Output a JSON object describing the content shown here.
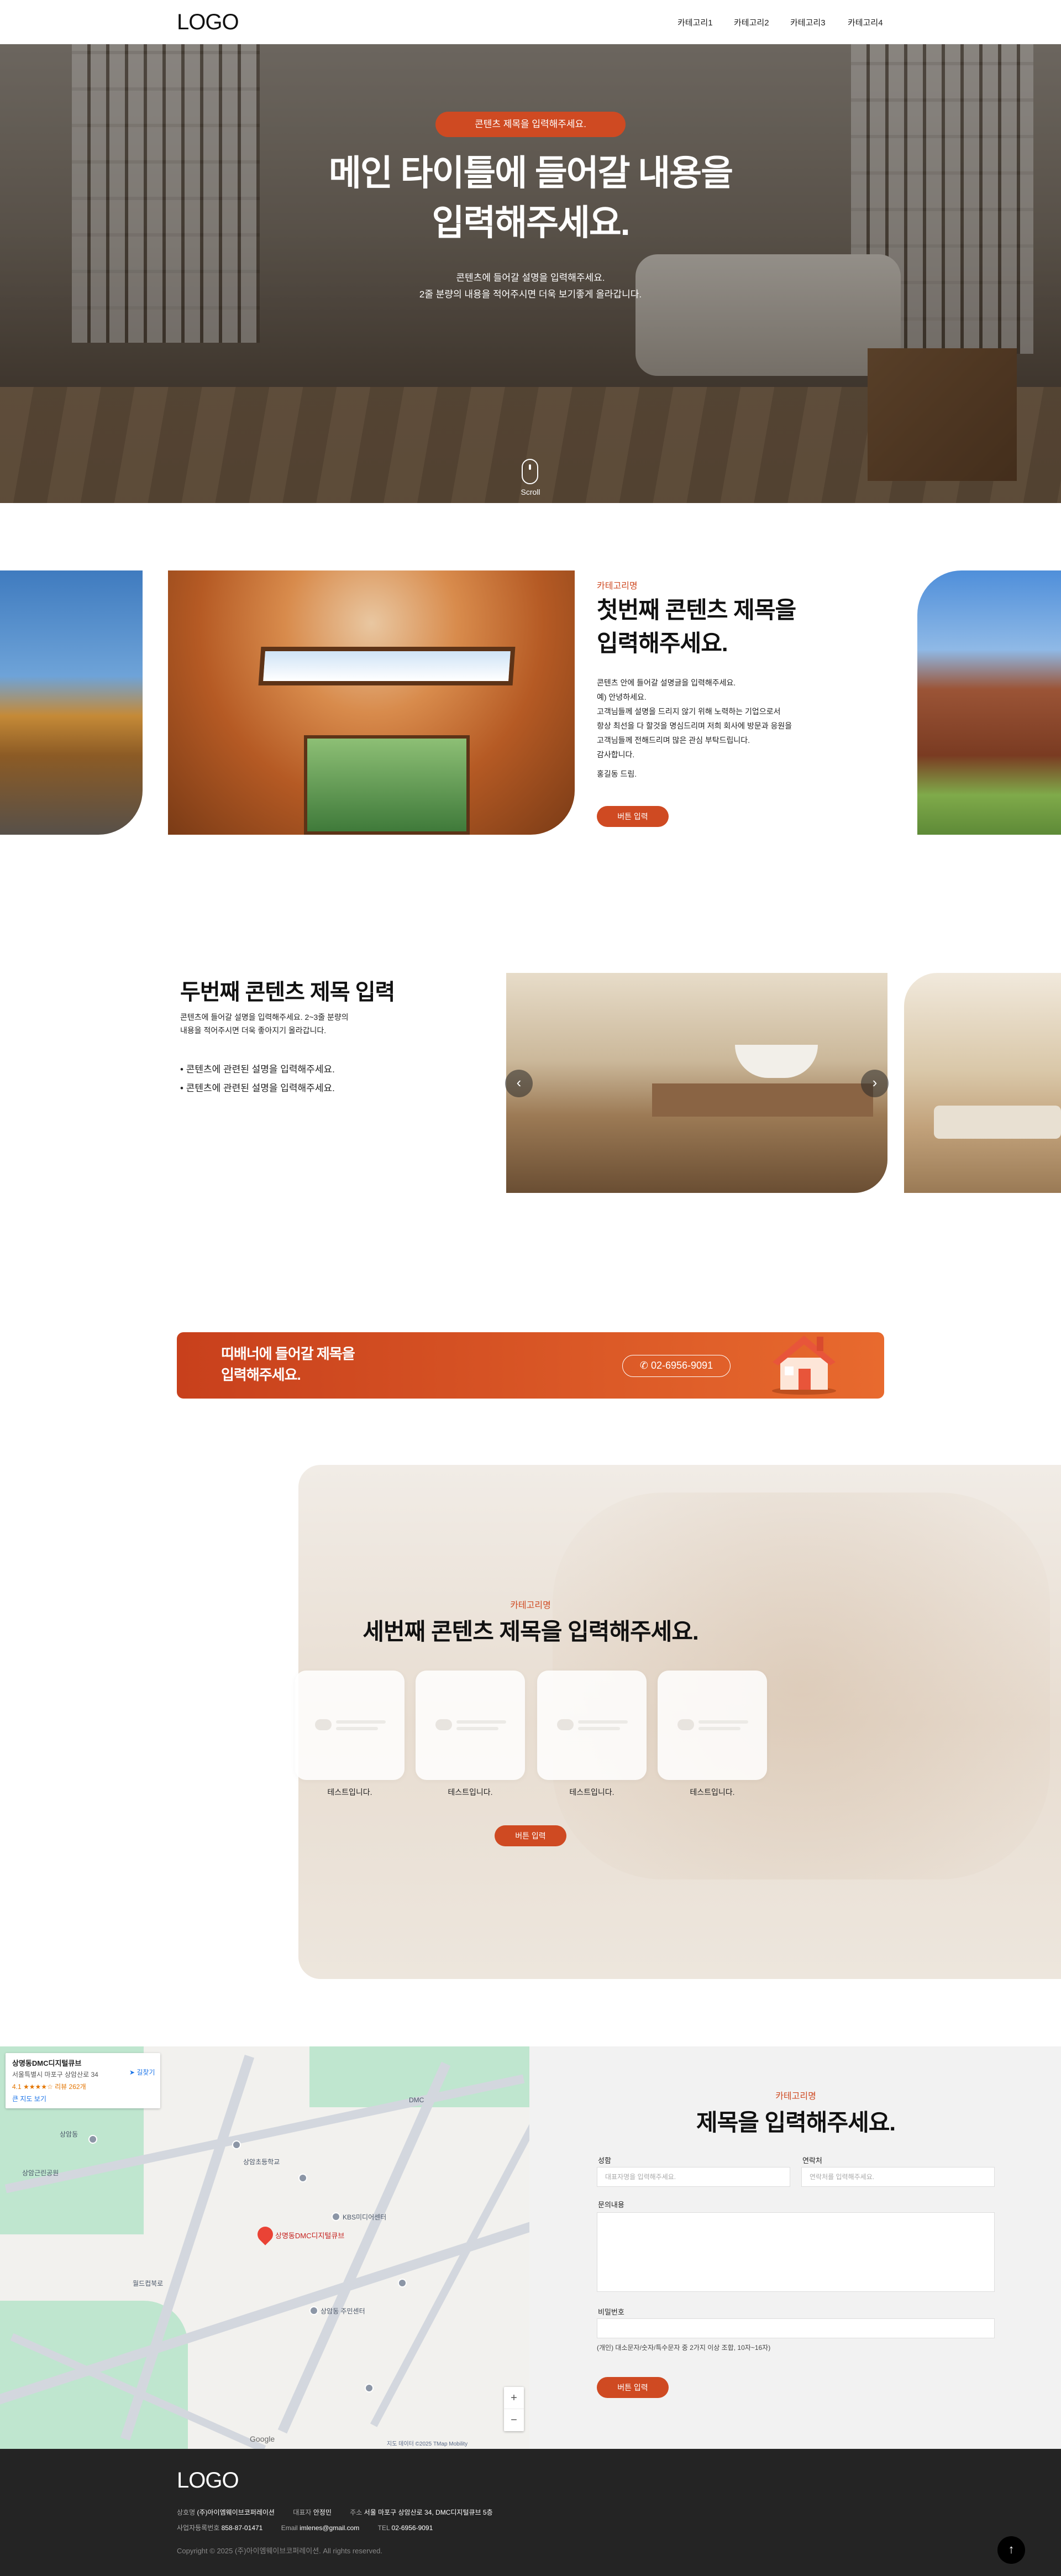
{
  "header": {
    "logo": "LOGO",
    "nav": [
      "카테고리1",
      "카테고리2",
      "카테고리3",
      "카테고리4"
    ]
  },
  "hero": {
    "badge": "콘텐츠 제목을 입력해주세요.",
    "title_line1": "메인 타이틀에 들어갈 내용을",
    "title_line2": "입력해주세요.",
    "desc_line1": "콘텐츠에 들어갈 설명을 입력해주세요.",
    "desc_line2": "2줄 분량의 내용을 적어주시면 더욱 보기좋게 올라갑니다.",
    "scroll": "Scroll"
  },
  "section1": {
    "category": "카테고리명",
    "title_line1": "첫번째 콘텐츠 제목을",
    "title_line2": "입력해주세요.",
    "body": [
      "콘텐츠 안에 들어갈 설명글을 입력해주세요.",
      "예) 안녕하세요.",
      "고객님들께 설명을 드리지 않기 위해 노력하는 기업으로서",
      "항상 최선을 다 할것을 명심드리며 저희 회사에 방문과 응원을",
      "고객님들께 전해드리며 많은 관심 부탁드립니다.",
      "감사합니다."
    ],
    "signature": "홍길동 드림.",
    "button": "버튼 입력"
  },
  "section2": {
    "title": "두번째 콘텐츠 제목 입력",
    "desc_line1": "콘텐츠에 들어갈 설명을 입력해주세요. 2~3줄 분량의",
    "desc_line2": "내용을 적어주시면 더욱 좋아지기 올라갑니다.",
    "bullets": [
      "콘텐츠에 관련된 설명을 입력해주세요.",
      "콘텐츠에 관련된 설명을 입력해주세요."
    ],
    "prev_icon": "‹",
    "next_icon": "›"
  },
  "banner": {
    "title_line1": "띠배너에 들어갈 제목을",
    "title_line2": "입력해주세요.",
    "phone": "02-6956-9091"
  },
  "section3": {
    "category": "카테고리명",
    "title": "세번째 콘텐츠 제목을 입력해주세요.",
    "cards": [
      {
        "label": "테스트입니다."
      },
      {
        "label": "테스트입니다."
      },
      {
        "label": "테스트입니다."
      },
      {
        "label": "테스트입니다."
      }
    ],
    "button": "버튼 입력"
  },
  "map": {
    "card_name": "상명동DMC디지털큐브",
    "card_address": "서울특별시 마포구 상암산로 34",
    "card_rating": "4.1 ★★★★☆ 리뷰 262개",
    "card_link": "큰 지도 보기",
    "directions": "길찾기",
    "marker_label": "상명동DMC디지털큐브",
    "labels": [
      "상암동",
      "상암근린공원",
      "DMC",
      "상암초등학교",
      "월드컵북로",
      "KBS미디어센터",
      "상암동 주민센터"
    ],
    "zoom_in": "+",
    "zoom_out": "−",
    "google": "Google",
    "footer_text": "지도 데이터 ©2025 TMap Mobility"
  },
  "contact": {
    "category": "카테고리명",
    "title": "제목을 입력해주세요.",
    "name_label": "성함",
    "name_placeholder": "대표자명을 입력해주세요.",
    "phone_label": "연락처",
    "phone_placeholder": "연락처를 입력해주세요.",
    "inquiry_label": "문의내용",
    "password_label": "비밀번호",
    "privacy_text": "(개인) 대소문자/숫자/특수문자 중 2가지 이상 조합, 10자~16자)",
    "submit": "버튼 입력"
  },
  "footer": {
    "logo": "LOGO",
    "row1": [
      {
        "label": "상호명",
        "value": "(주)아이엠웨이브코퍼레이션"
      },
      {
        "label": "대표자",
        "value": "안정민"
      },
      {
        "label": "주소",
        "value": "서울 마포구 상암산로 34, DMC디지털큐브 5층"
      }
    ],
    "row2": [
      {
        "label": "사업자등록번호",
        "value": "858-87-01471"
      },
      {
        "label": "Email",
        "value": "imlenes@gmail.com"
      },
      {
        "label": "TEL",
        "value": "02-6956-9091"
      }
    ],
    "copyright": "Copyright © 2025 (주)아이엠웨이브코퍼레이션. All rights reserved.",
    "top_icon": "↑"
  },
  "colors": {
    "accent": "#cf4a22",
    "footer_bg": "#242424",
    "contact_bg": "#f2f2f2"
  }
}
